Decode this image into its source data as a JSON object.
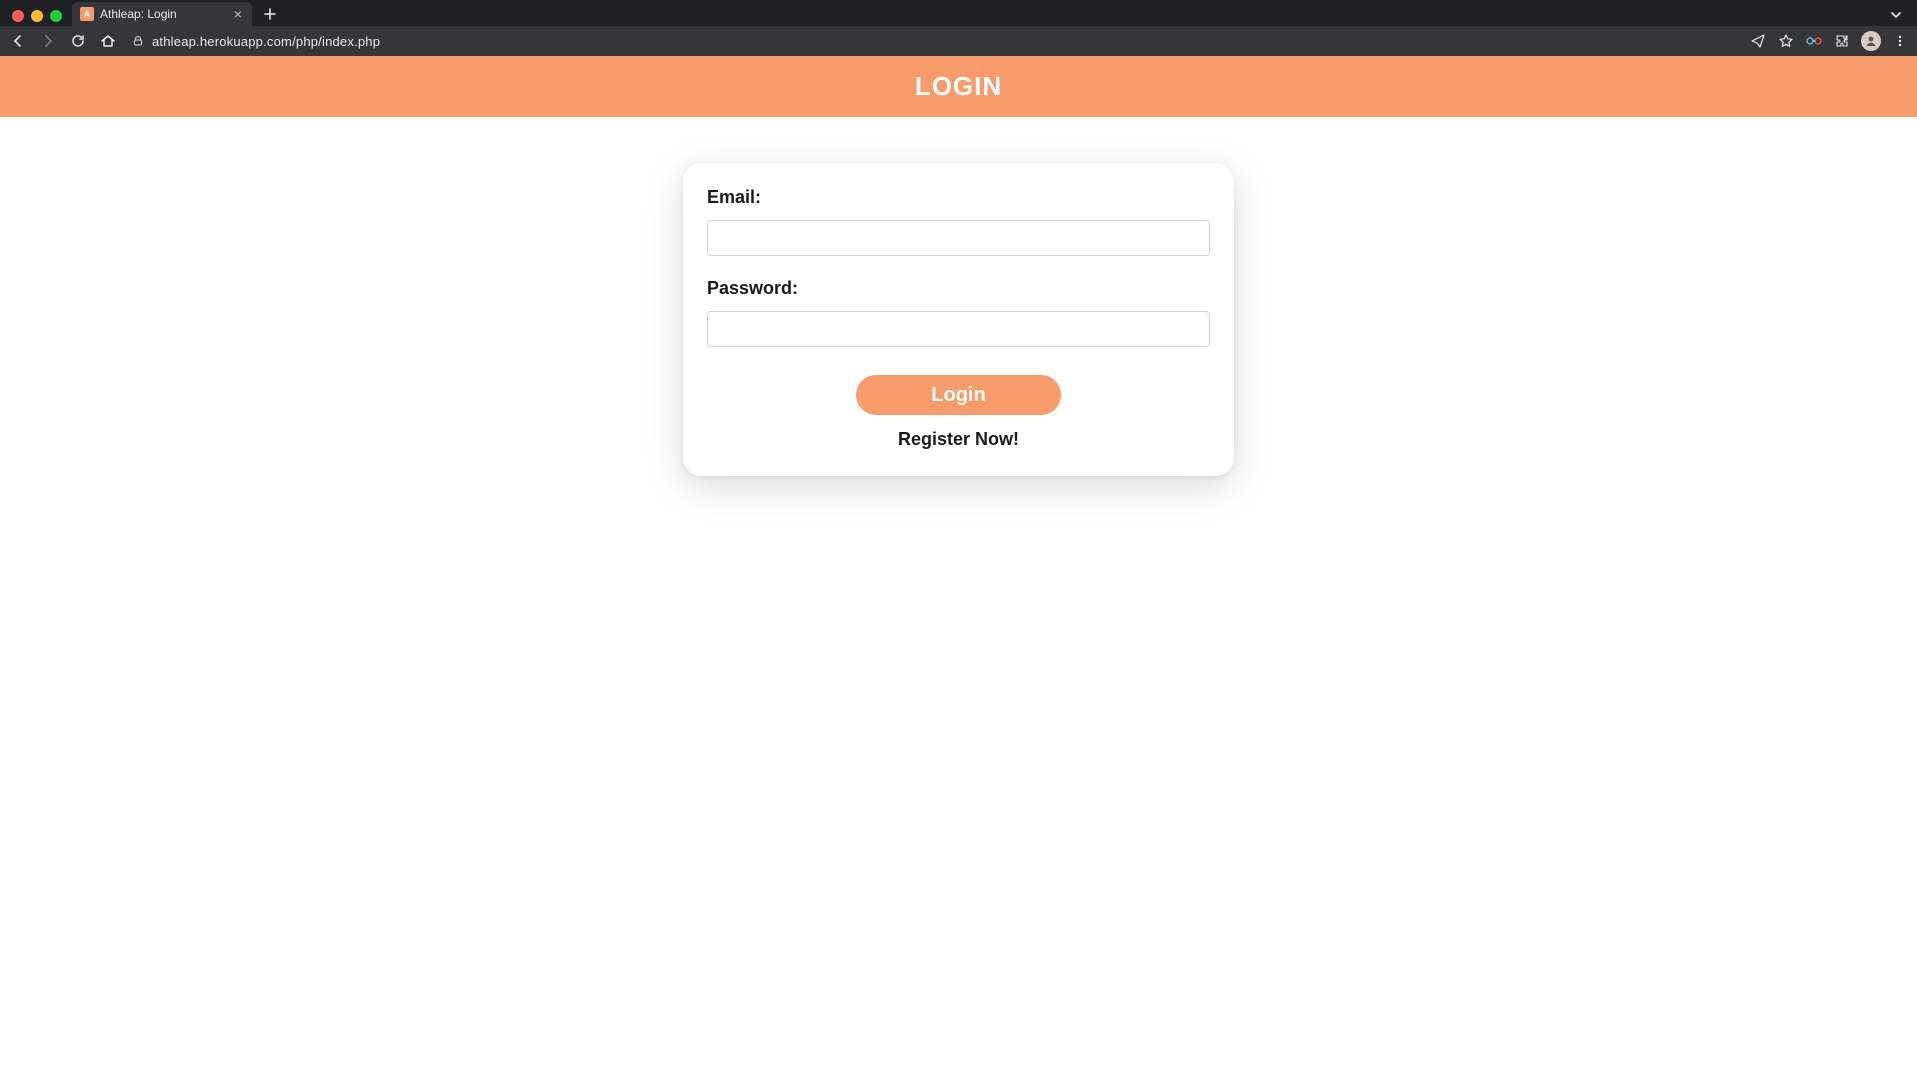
{
  "browser": {
    "tab_title": "Athleap: Login",
    "url_display": "athleap.herokuapp.com/php/index.php",
    "favicon_letter": "A"
  },
  "page": {
    "hero_title": "LOGIN",
    "email_label": "Email:",
    "password_label": "Password:",
    "email_value": "",
    "password_value": "",
    "login_button": "Login",
    "register_link": "Register Now!"
  },
  "colors": {
    "accent": "#f79c6a"
  }
}
